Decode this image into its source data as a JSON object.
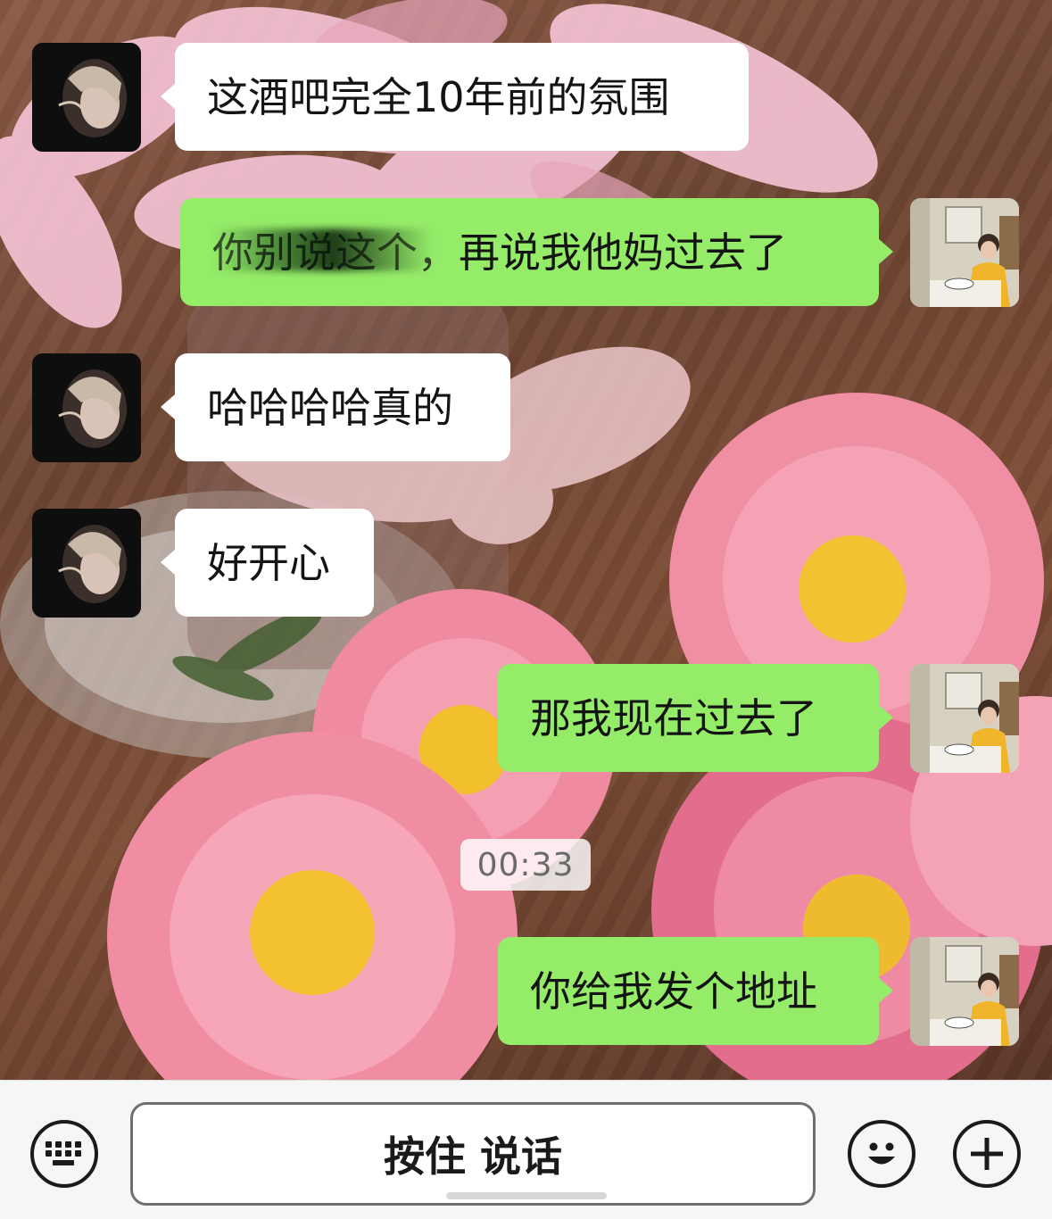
{
  "messages": [
    {
      "side": "in",
      "text": "这酒吧完全10年前的氛围"
    },
    {
      "side": "out",
      "text": "你别说这个，再说我他妈过去了"
    },
    {
      "side": "in",
      "text": "哈哈哈哈真的"
    },
    {
      "side": "in",
      "text": "好开心"
    },
    {
      "side": "out",
      "text": "那我现在过去了"
    },
    {
      "side": "out",
      "text": "你给我发个地址"
    }
  ],
  "timestamp": "00:33",
  "input_bar": {
    "hold_to_talk_label": "按住 说话",
    "left_icon": "keyboard-icon",
    "emoji_icon": "emoji-icon",
    "plus_icon": "plus-icon"
  },
  "colors": {
    "outgoing_bubble": "#95ec69",
    "incoming_bubble": "#ffffff"
  }
}
